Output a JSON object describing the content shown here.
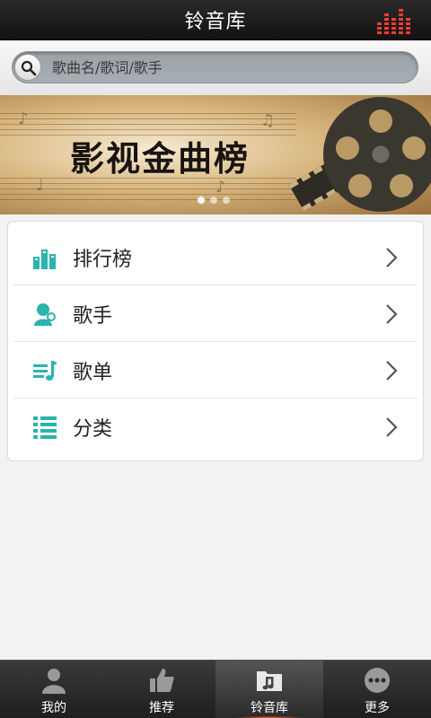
{
  "header": {
    "title": "铃音库",
    "icon": "equalizer-icon",
    "accent": "#ff3b2f"
  },
  "search": {
    "placeholder": "歌曲名/歌词/歌手",
    "icon": "search-icon"
  },
  "banner": {
    "text": "影视金曲榜",
    "page_count": 3,
    "active_page": 1
  },
  "menu": {
    "items": [
      {
        "label": "排行榜",
        "icon": "chart-icon"
      },
      {
        "label": "歌手",
        "icon": "singer-icon"
      },
      {
        "label": "歌单",
        "icon": "playlist-icon"
      },
      {
        "label": "分类",
        "icon": "category-list-icon"
      }
    ],
    "icon_color": "#2bb3ad"
  },
  "tabbar": {
    "tabs": [
      {
        "label": "我的",
        "icon": "user-icon",
        "active": false
      },
      {
        "label": "推荐",
        "icon": "thumbs-up-icon",
        "active": false
      },
      {
        "label": "铃音库",
        "icon": "music-folder-icon",
        "active": true
      },
      {
        "label": "更多",
        "icon": "more-icon",
        "active": false
      }
    ]
  }
}
